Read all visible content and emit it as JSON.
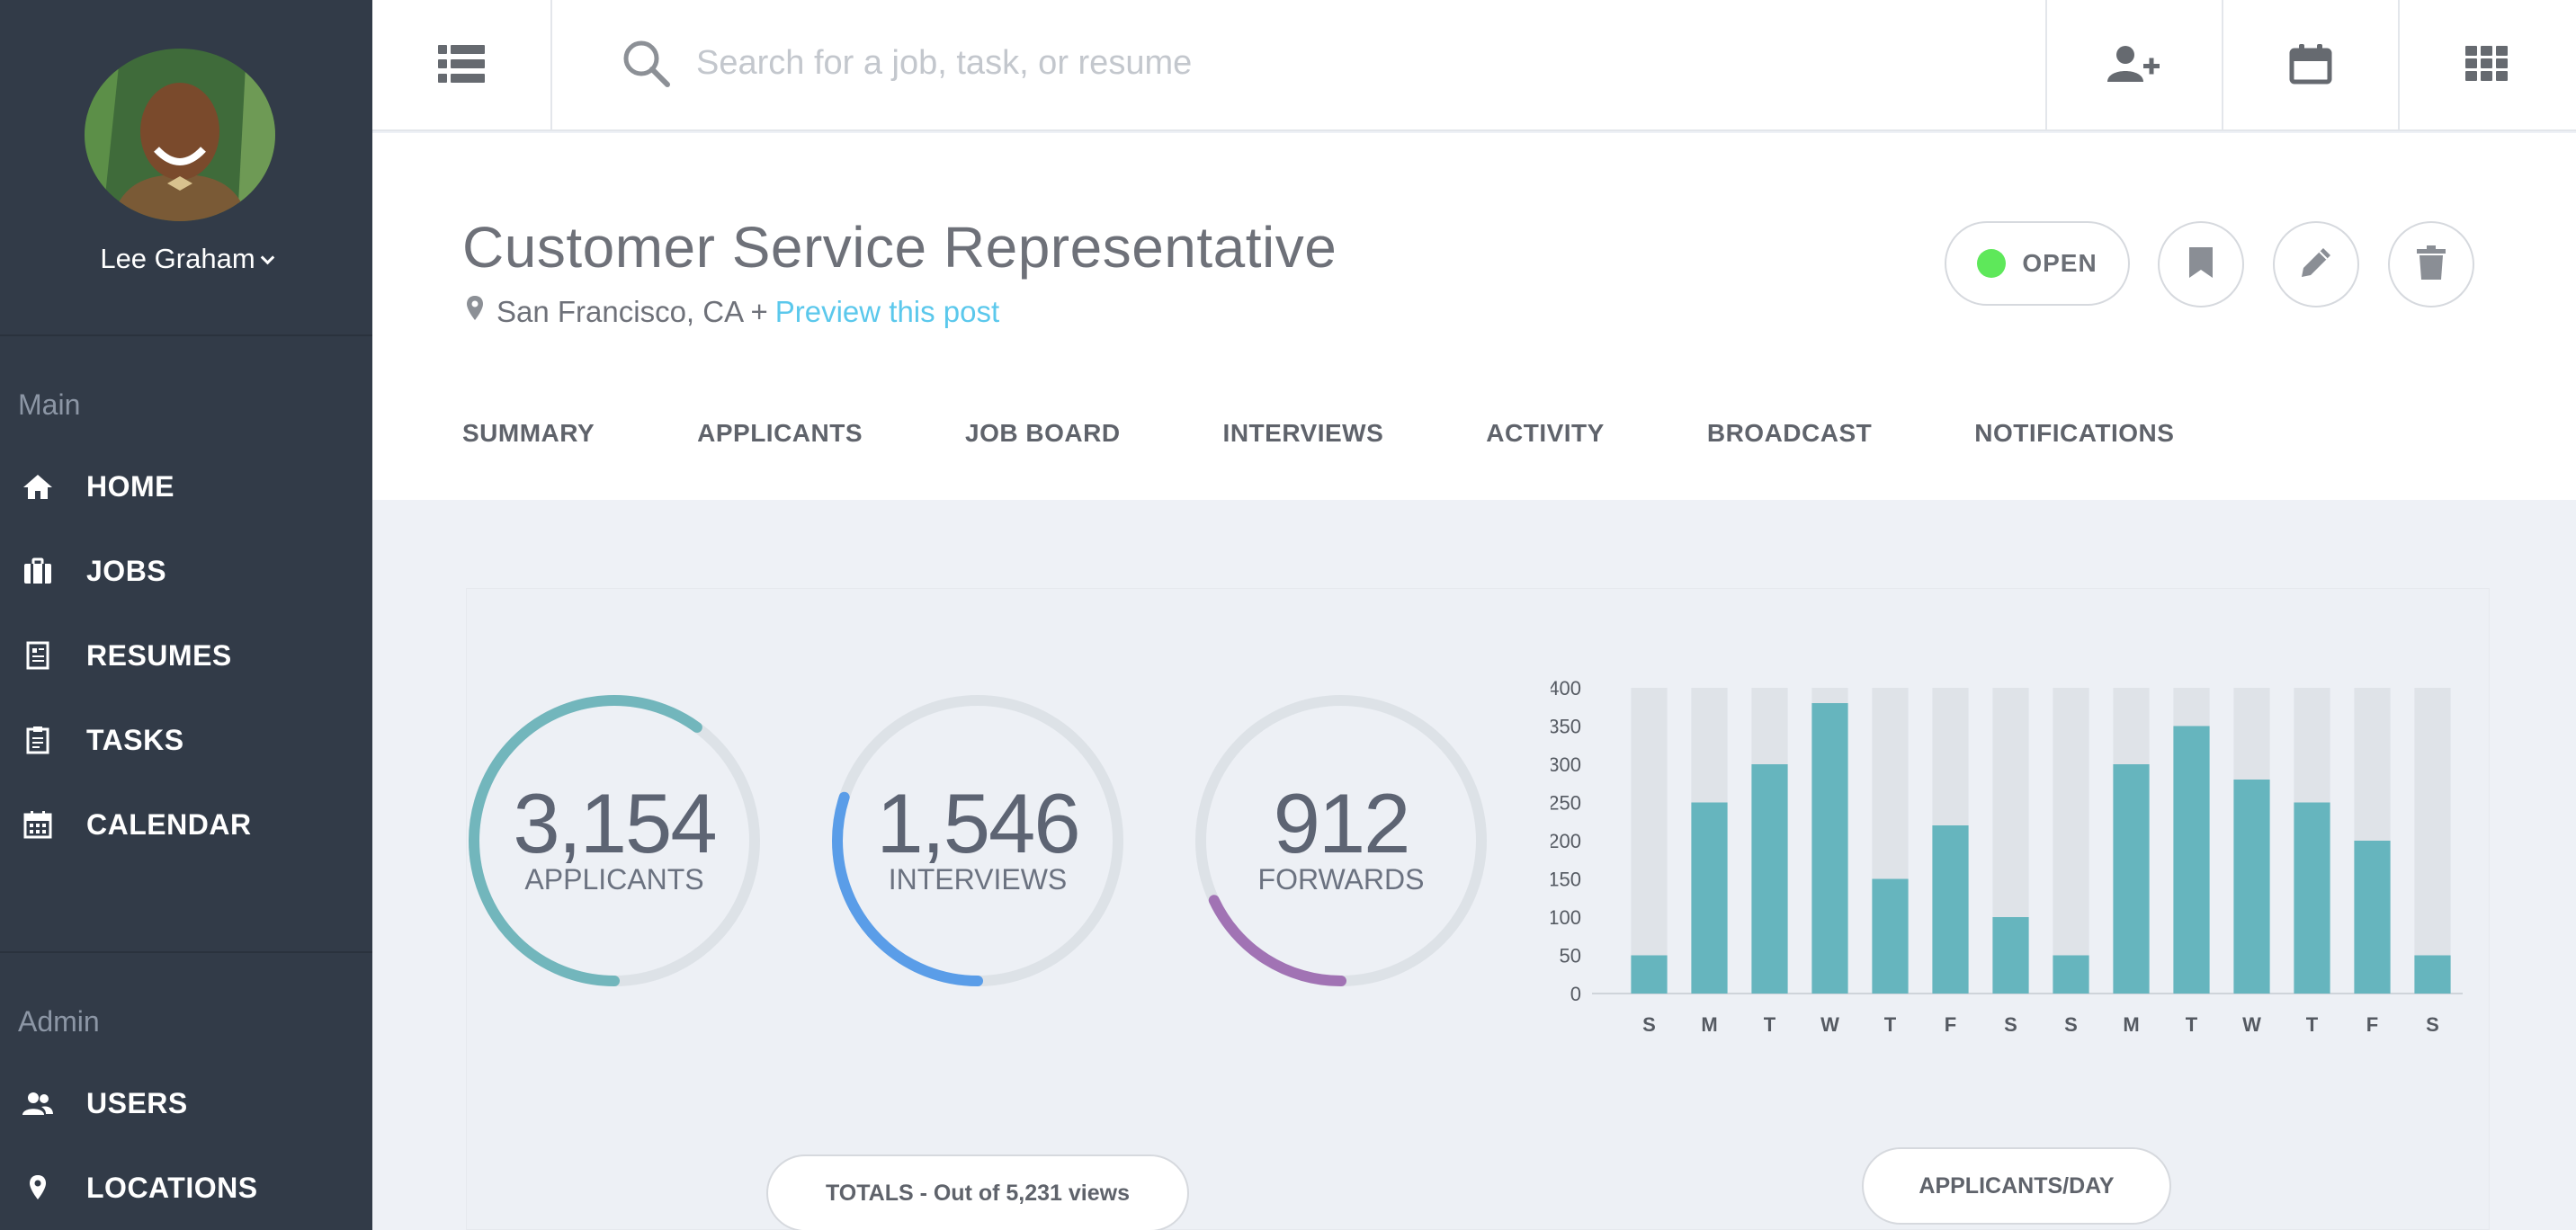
{
  "user": {
    "name": "Lee Graham"
  },
  "sidebar": {
    "main_label": "Main",
    "main_items": [
      {
        "label": "HOME",
        "icon": "home-icon"
      },
      {
        "label": "JOBS",
        "icon": "briefcase-icon"
      },
      {
        "label": "RESUMES",
        "icon": "resume-icon"
      },
      {
        "label": "TASKS",
        "icon": "clipboard-icon"
      },
      {
        "label": "CALENDAR",
        "icon": "calendar-icon"
      }
    ],
    "admin_label": "Admin",
    "admin_items": [
      {
        "label": "USERS",
        "icon": "users-icon"
      },
      {
        "label": "LOCATIONS",
        "icon": "location-pin-icon"
      }
    ]
  },
  "topbar": {
    "search_placeholder": "Search for a job, task, or resume"
  },
  "job": {
    "title": "Customer Service Representative",
    "location": "San Francisco, CA +",
    "preview_link": "Preview this post",
    "status": "OPEN"
  },
  "tabs": [
    "SUMMARY",
    "APPLICANTS",
    "JOB BOARD",
    "INTERVIEWS",
    "ACTIVITY",
    "BROADCAST",
    "NOTIFICATIONS"
  ],
  "stats": [
    {
      "value": "3,154",
      "label": "APPLICANTS",
      "progress": 0.6,
      "color": "#72b6bc"
    },
    {
      "value": "1,546",
      "label": "INTERVIEWS",
      "progress": 0.3,
      "color": "#5a9de8"
    },
    {
      "value": "912",
      "label": "FORWARDS",
      "progress": 0.18,
      "color": "#a173b4"
    }
  ],
  "totals_button": "TOTALS - Out of 5,231 views",
  "chart_button": "APPLICANTS/DAY",
  "colors": {
    "sidebar": "#323b48",
    "bar": "#66b5be",
    "bar_bg": "#dfe3e8",
    "link": "#5bc8ec",
    "status": "#5ee85a"
  },
  "chart_data": {
    "type": "bar",
    "categories": [
      "S",
      "M",
      "T",
      "W",
      "T",
      "F",
      "S",
      "S",
      "M",
      "T",
      "W",
      "T",
      "F",
      "S"
    ],
    "values": [
      50,
      250,
      300,
      380,
      150,
      220,
      100,
      50,
      300,
      350,
      280,
      250,
      200,
      50
    ],
    "ylim": [
      0,
      400
    ],
    "yticks": [
      0,
      50,
      100,
      150,
      200,
      250,
      300,
      350,
      400
    ]
  }
}
